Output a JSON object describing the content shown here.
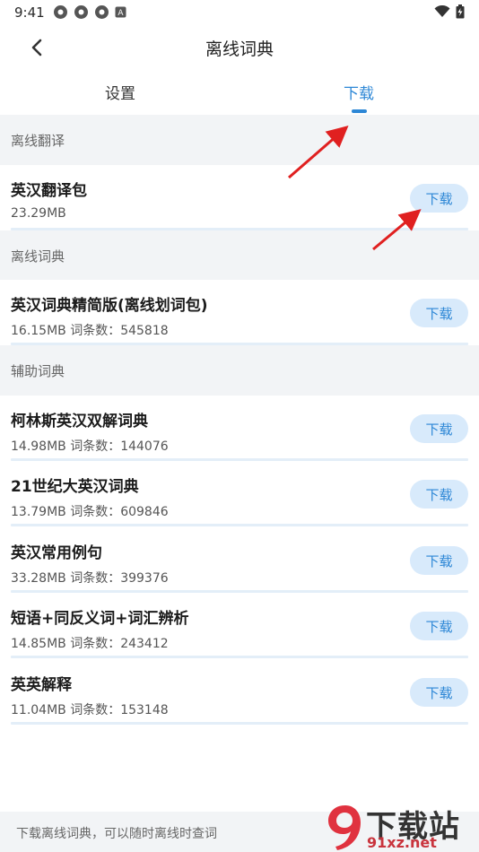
{
  "status_bar": {
    "time": "9:41"
  },
  "app_bar": {
    "title": "离线词典"
  },
  "tabs": [
    {
      "label": "设置",
      "selected": false
    },
    {
      "label": "下载",
      "selected": true
    }
  ],
  "sections": [
    {
      "header": "离线翻译"
    },
    {
      "header": "离线词典"
    },
    {
      "header": "辅助词典"
    }
  ],
  "items": [
    {
      "title": "英汉翻译包",
      "size": "23.29MB",
      "meta": "23.29MB",
      "button": "下载"
    },
    {
      "title": "英汉词典精简版(离线划词包)",
      "meta": "16.15MB   词条数：545818",
      "button": "下载"
    },
    {
      "title": "柯林斯英汉双解词典",
      "meta": "14.98MB   词条数：144076",
      "button": "下载"
    },
    {
      "title": "21世纪大英汉词典",
      "meta": "13.79MB   词条数：609846",
      "button": "下载"
    },
    {
      "title": "英汉常用例句",
      "meta": "33.28MB   词条数：399376",
      "button": "下载"
    },
    {
      "title": "短语+同反义词+词汇辨析",
      "meta": "14.85MB   词条数：243412",
      "button": "下载"
    },
    {
      "title": "英英解释",
      "meta": "11.04MB   词条数：153148",
      "button": "下载"
    }
  ],
  "footer": {
    "text": "下载离线词典，可以随时离线时查词"
  },
  "watermark": {
    "logo_text": "下载站",
    "url": "91xz.net"
  },
  "colors": {
    "accent": "#2d87d6",
    "button_bg": "#d8eafb",
    "arrow": "#e02020"
  }
}
